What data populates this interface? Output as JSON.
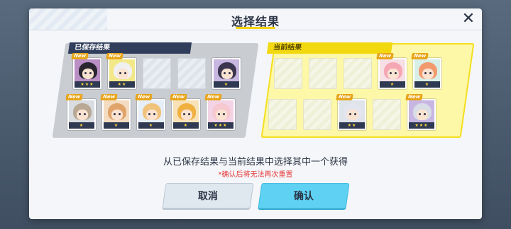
{
  "dialog": {
    "title": "选择结果",
    "close_glyph": "✕",
    "instruction": "从已保存结果与当前结果中选择其中一个获得",
    "warning": "*确认后将无法再次重置",
    "cancel_label": "取消",
    "confirm_label": "确认"
  },
  "saved": {
    "label": "已保存结果",
    "cards": [
      {
        "empty": false,
        "new": "New",
        "stars": "★★★",
        "hair": "#2a2630",
        "bg": "#b98fc6"
      },
      {
        "empty": false,
        "new": "New",
        "stars": "★★",
        "hair": "#f0f0f3",
        "bg": "#f2e88a"
      },
      {
        "empty": true
      },
      {
        "empty": true
      },
      {
        "empty": false,
        "new": "",
        "stars": "★",
        "hair": "#3b3550",
        "bg": "#c7b6df"
      },
      {
        "empty": false,
        "new": "New",
        "stars": "★",
        "hair": "#b8a894",
        "bg": "#d9dde2"
      },
      {
        "empty": false,
        "new": "New",
        "stars": "★",
        "hair": "#e0a46a",
        "bg": "#f3dcc2"
      },
      {
        "empty": false,
        "new": "New",
        "stars": "★",
        "hair": "#f0c27a",
        "bg": "#e6eef7"
      },
      {
        "empty": false,
        "new": "New",
        "stars": "★",
        "hair": "#f0b040",
        "bg": "#f7e2b8"
      },
      {
        "empty": false,
        "new": "New",
        "stars": "★★★",
        "hair": "#f6c8d0",
        "bg": "#f3d3e6"
      }
    ]
  },
  "current": {
    "label": "当前结果",
    "check_glyph": "✔",
    "cards": [
      {
        "empty": true
      },
      {
        "empty": true
      },
      {
        "empty": true
      },
      {
        "empty": false,
        "new": "New",
        "stars": "★",
        "hair": "#f6a7b4",
        "bg": "#f6e0e6"
      },
      {
        "empty": false,
        "new": "New",
        "stars": "★",
        "hair": "#f29a6e",
        "bg": "#d8efe7"
      },
      {
        "empty": true
      },
      {
        "empty": true
      },
      {
        "empty": false,
        "new": "New",
        "stars": "★★",
        "hair": "#e4e6ef",
        "bg": "#dfe3ea"
      },
      {
        "empty": true
      },
      {
        "empty": false,
        "new": "New",
        "stars": "★★★",
        "hair": "#d8dde6",
        "bg": "#c8b6e2"
      }
    ]
  },
  "colors": {
    "accent_yellow": "#f2d80e",
    "confirm_blue": "#5fd2f4",
    "warning_red": "#e63a3a",
    "label_navy": "#303e5c"
  }
}
